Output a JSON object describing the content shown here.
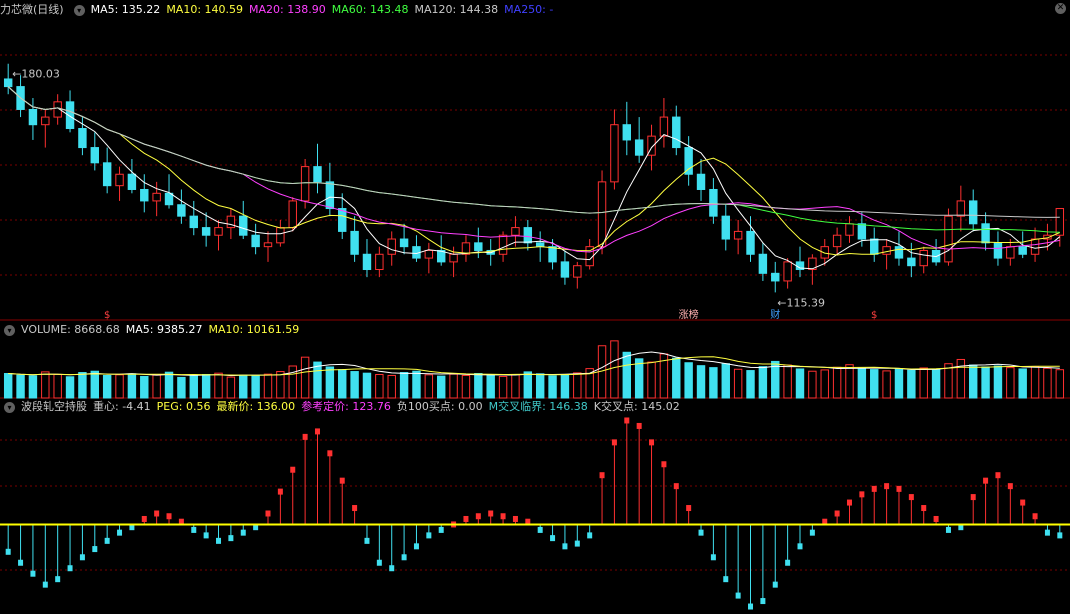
{
  "price_header": {
    "title": "力芯微(日线)",
    "ma": [
      {
        "label": "MA5: 135.22",
        "color": "#ffffff"
      },
      {
        "label": "MA10: 140.59",
        "color": "#ffff40"
      },
      {
        "label": "MA20: 138.90",
        "color": "#ff40ff"
      },
      {
        "label": "MA60: 143.48",
        "color": "#40ff40"
      },
      {
        "label": "MA120: 144.38",
        "color": "#c8c8c8"
      },
      {
        "label": "MA250: -",
        "color": "#4040ff"
      }
    ]
  },
  "volume_header": {
    "items": [
      {
        "label": "VOLUME: 8668.68",
        "color": "#c8c8c8"
      },
      {
        "label": "MA5: 9385.27",
        "color": "#ffffff"
      },
      {
        "label": "MA10: 10161.59",
        "color": "#ffff40"
      }
    ]
  },
  "ind_header": {
    "items": [
      {
        "label": "波段轧空持股",
        "color": "#c8c8c8"
      },
      {
        "label": "重心: -4.41",
        "color": "#c8c8c8"
      },
      {
        "label": "PEG: 0.56",
        "color": "#ffff40"
      },
      {
        "label": "最新价: 136.00",
        "color": "#ffff40"
      },
      {
        "label": "参考定价: 123.76",
        "color": "#ff40ff"
      },
      {
        "label": "负100买点: 0.00",
        "color": "#c8c8c8"
      },
      {
        "label": "M交叉临界: 146.38",
        "color": "#40c8c8"
      },
      {
        "label": "K交叉点: 145.02",
        "color": "#c8c8c8"
      }
    ]
  },
  "annotations": {
    "high_label": "180.03",
    "low_label": "115.39",
    "event_labels": [
      "$",
      "涨榜",
      "财",
      "$"
    ]
  },
  "colors": {
    "up": "#ff3030",
    "down": "#40e0f0",
    "bg": "#000000",
    "grid": "#7a0000",
    "zero_line": "#ffff00"
  },
  "chart_data": [
    {
      "type": "candlestick",
      "title": "力芯微(日线)",
      "ylim": [
        112,
        186
      ],
      "points": [
        [
          170,
          174,
          166,
          168
        ],
        [
          168,
          171,
          160,
          162
        ],
        [
          162,
          165,
          154,
          158
        ],
        [
          158,
          162,
          152,
          160
        ],
        [
          160,
          166,
          158,
          164
        ],
        [
          164,
          167,
          156,
          157
        ],
        [
          157,
          160,
          150,
          152
        ],
        [
          152,
          156,
          146,
          148
        ],
        [
          148,
          152,
          140,
          142
        ],
        [
          142,
          147,
          138,
          145
        ],
        [
          145,
          149,
          140,
          141
        ],
        [
          141,
          145,
          135,
          138
        ],
        [
          138,
          143,
          134,
          140
        ],
        [
          140,
          145,
          136,
          137
        ],
        [
          137,
          141,
          132,
          134
        ],
        [
          134,
          138,
          129,
          131
        ],
        [
          131,
          135,
          126,
          129
        ],
        [
          129,
          133,
          125,
          131
        ],
        [
          131,
          136,
          128,
          134
        ],
        [
          134,
          138,
          128,
          129
        ],
        [
          129,
          132,
          124,
          126
        ],
        [
          126,
          130,
          122,
          127
        ],
        [
          127,
          133,
          126,
          131
        ],
        [
          131,
          139,
          130,
          138
        ],
        [
          138,
          149,
          136,
          147
        ],
        [
          147,
          153,
          140,
          143
        ],
        [
          143,
          148,
          134,
          136
        ],
        [
          136,
          140,
          128,
          130
        ],
        [
          130,
          134,
          122,
          124
        ],
        [
          124,
          128,
          118,
          120
        ],
        [
          120,
          126,
          118,
          124
        ],
        [
          124,
          130,
          121,
          128
        ],
        [
          128,
          132,
          124,
          126
        ],
        [
          126,
          129,
          122,
          123
        ],
        [
          123,
          127,
          119,
          125
        ],
        [
          125,
          129,
          121,
          122
        ],
        [
          122,
          126,
          118,
          124
        ],
        [
          124,
          129,
          122,
          127
        ],
        [
          127,
          131,
          123,
          125
        ],
        [
          125,
          128,
          121,
          124
        ],
        [
          124,
          130,
          122,
          129
        ],
        [
          129,
          134,
          126,
          131
        ],
        [
          131,
          133,
          125,
          127
        ],
        [
          127,
          130,
          122,
          126
        ],
        [
          126,
          128,
          120,
          122
        ],
        [
          122,
          125,
          116,
          118
        ],
        [
          118,
          122,
          115,
          121
        ],
        [
          121,
          128,
          120,
          126
        ],
        [
          126,
          146,
          124,
          143
        ],
        [
          143,
          162,
          141,
          158
        ],
        [
          158,
          164,
          150,
          154
        ],
        [
          154,
          160,
          148,
          150
        ],
        [
          150,
          158,
          146,
          155
        ],
        [
          155,
          165,
          152,
          160
        ],
        [
          160,
          163,
          150,
          152
        ],
        [
          152,
          155,
          142,
          145
        ],
        [
          145,
          149,
          138,
          141
        ],
        [
          141,
          144,
          132,
          134
        ],
        [
          134,
          137,
          125,
          128
        ],
        [
          128,
          133,
          124,
          130
        ],
        [
          130,
          134,
          122,
          124
        ],
        [
          124,
          127,
          117,
          119
        ],
        [
          119,
          122,
          114,
          117
        ],
        [
          117,
          123,
          115,
          122
        ],
        [
          122,
          126,
          118,
          120
        ],
        [
          120,
          124,
          116,
          123
        ],
        [
          123,
          128,
          121,
          126
        ],
        [
          126,
          131,
          124,
          129
        ],
        [
          129,
          134,
          127,
          132
        ],
        [
          132,
          135,
          126,
          128
        ],
        [
          128,
          131,
          122,
          124
        ],
        [
          124,
          128,
          120,
          126
        ],
        [
          126,
          130,
          121,
          123
        ],
        [
          123,
          127,
          118,
          121
        ],
        [
          121,
          126,
          119,
          125
        ],
        [
          125,
          128,
          121,
          122
        ],
        [
          122,
          136,
          121,
          134
        ],
        [
          134,
          142,
          130,
          138
        ],
        [
          138,
          141,
          130,
          132
        ],
        [
          132,
          135,
          125,
          127
        ],
        [
          127,
          130,
          121,
          123
        ],
        [
          123,
          128,
          121,
          126
        ],
        [
          126,
          130,
          123,
          124
        ],
        [
          124,
          131,
          122,
          128
        ],
        [
          128,
          132,
          125,
          129
        ],
        [
          129,
          133,
          126,
          136
        ]
      ]
    },
    {
      "type": "bar",
      "title": "VOLUME",
      "values": [
        7500,
        7000,
        6800,
        8000,
        7200,
        6500,
        7800,
        8200,
        6900,
        7100,
        7400,
        6600,
        7000,
        7900,
        6300,
        6800,
        7200,
        7600,
        6400,
        7000,
        6800,
        7300,
        8100,
        9800,
        12500,
        11000,
        9500,
        8700,
        8100,
        7600,
        7200,
        6900,
        7800,
        8200,
        7100,
        6700,
        7300,
        6900,
        7500,
        7000,
        6600,
        7200,
        8000,
        7400,
        6800,
        7100,
        7700,
        9000,
        16000,
        17500,
        14000,
        12000,
        11000,
        13500,
        12200,
        10800,
        9900,
        9300,
        10500,
        8800,
        8400,
        9600,
        11200,
        10100,
        8900,
        8200,
        8600,
        9400,
        10200,
        9100,
        8700,
        8300,
        9000,
        8500,
        9200,
        8800,
        10500,
        11800,
        10100,
        9500,
        9800,
        9300,
        8900,
        9600,
        9100,
        8668.68
      ],
      "ma5": 9385.27,
      "ma10": 10161.59
    },
    {
      "type": "bar",
      "title": "波段轧空持股",
      "values": [
        -10,
        -14,
        -18,
        -22,
        -20,
        -16,
        -12,
        -9,
        -6,
        -3,
        -1,
        2,
        4,
        3,
        1,
        -2,
        -4,
        -6,
        -5,
        -3,
        -1,
        4,
        12,
        20,
        32,
        34,
        26,
        16,
        6,
        -6,
        -14,
        -16,
        -12,
        -8,
        -4,
        -2,
        0,
        2,
        3,
        4,
        3,
        2,
        1,
        -2,
        -5,
        -8,
        -7,
        -4,
        18,
        30,
        38,
        36,
        30,
        22,
        14,
        6,
        -3,
        -12,
        -20,
        -26,
        -30,
        -28,
        -22,
        -14,
        -8,
        -3,
        1,
        4,
        8,
        11,
        13,
        14,
        13,
        10,
        6,
        2,
        -2,
        -1,
        10,
        16,
        18,
        14,
        8,
        3,
        -3,
        -4
      ],
      "ylim": [
        -32,
        40
      ]
    }
  ]
}
